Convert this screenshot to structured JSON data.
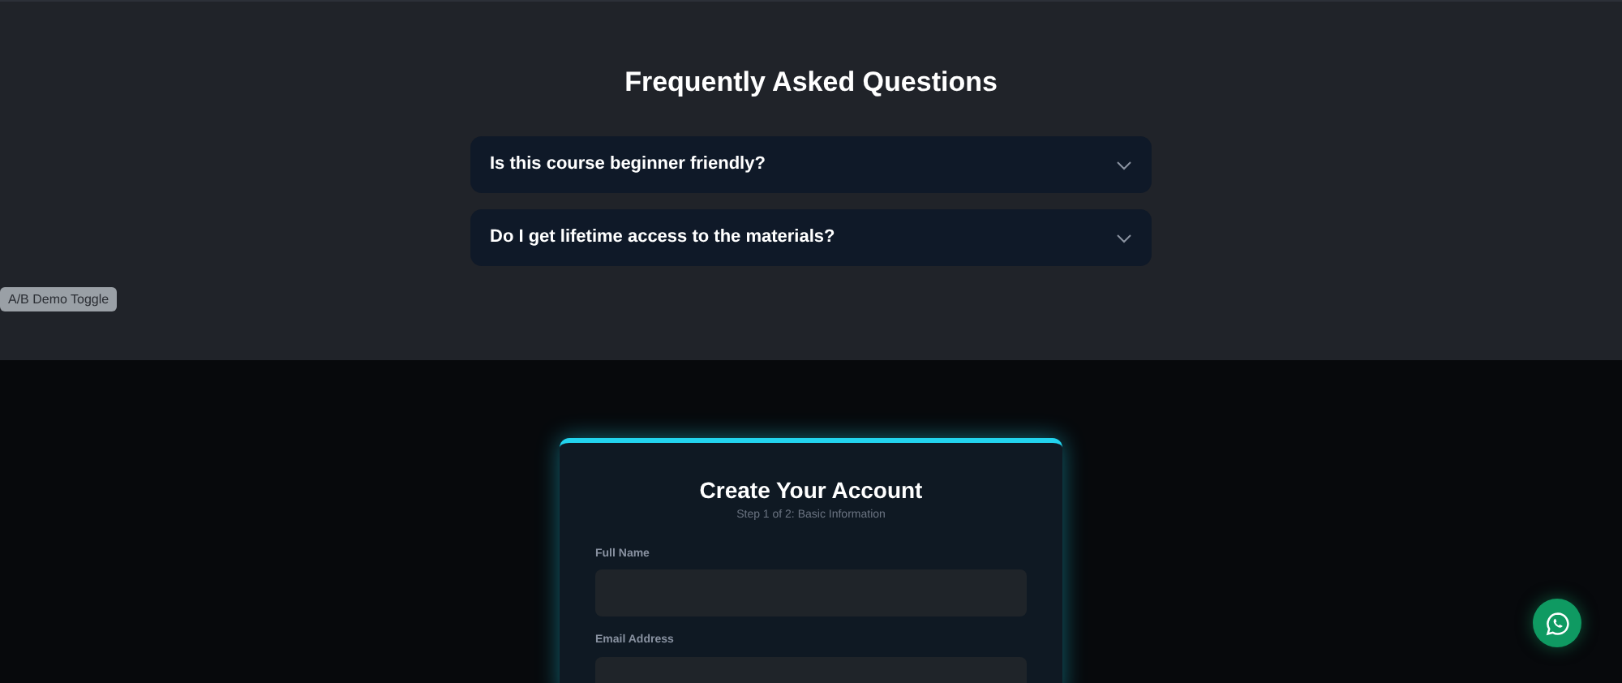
{
  "faq": {
    "title": "Frequently Asked Questions",
    "items": [
      {
        "question": "Is this course beginner friendly?",
        "expanded": false
      },
      {
        "question": "Do I get lifetime access to the materials?",
        "expanded": false
      }
    ]
  },
  "demo_toggle": {
    "label": "A/B Demo Toggle"
  },
  "signup": {
    "title": "Create Your Account",
    "subtitle": "Step 1 of 2: Basic Information",
    "fields": [
      {
        "label": "Full Name"
      },
      {
        "label": "Email Address"
      }
    ]
  }
}
